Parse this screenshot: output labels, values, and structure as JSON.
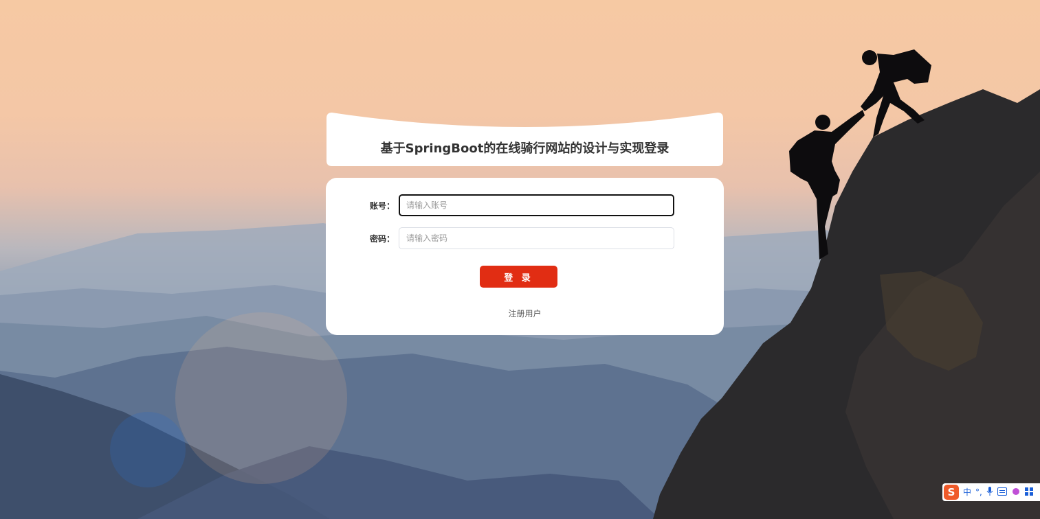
{
  "header": {
    "title": "基于SpringBoot的在线骑行网站的设计与实现登录"
  },
  "form": {
    "account_label": "账号：",
    "account_placeholder": "请输入账号",
    "password_label": "密码：",
    "password_placeholder": "请输入密码",
    "login_label": "登 录",
    "register_label": "注册用户"
  },
  "ime_toolbar": {
    "logo": "S",
    "lang": "中",
    "punct": "°,",
    "icons": [
      "microphone-icon",
      "keyboard-icon",
      "skin-icon",
      "toolbox-icon"
    ]
  },
  "colors": {
    "accent": "#e12d13",
    "ime_logo": "#ef5a2a",
    "ime_text": "#1a5fd8"
  }
}
